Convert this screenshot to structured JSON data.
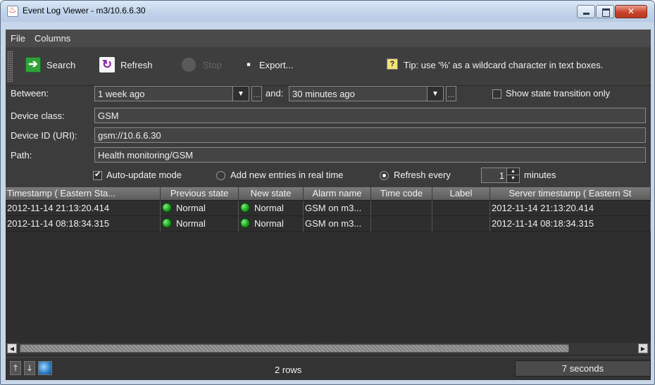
{
  "window": {
    "title": "Event Log Viewer - m3/10.6.6.30"
  },
  "menu": {
    "items": [
      "File",
      "Columns"
    ]
  },
  "toolbar": {
    "search_label": "Search",
    "refresh_label": "Refresh",
    "stop_label": "Stop",
    "export_label": "Export...",
    "tip_text": "Tip: use '%' as a wildcard character in text boxes."
  },
  "filters": {
    "between_label": "Between:",
    "between_value": "1 week ago",
    "and_label": "and:",
    "and_value": "30 minutes ago",
    "show_transitions_label": "Show state transition only",
    "show_transitions_checked": false,
    "device_class_label": "Device class:",
    "device_class_value": "GSM",
    "device_id_label": "Device ID (URI):",
    "device_id_value": "gsm://10.6.6.30",
    "path_label": "Path:",
    "path_value": "Health monitoring/GSM",
    "ellipsis": "...",
    "auto_update_label": "Auto-update mode",
    "auto_update_checked": true,
    "realtime_label": "Add new entries in real time",
    "refresh_every_label": "Refresh every",
    "refresh_every_value": "1",
    "refresh_every_unit": "minutes",
    "selected_mode": "refresh_every"
  },
  "table": {
    "columns": [
      "Timestamp ( Eastern Sta...",
      "Previous state",
      "New state",
      "Alarm name",
      "Time code",
      "Label",
      "Server timestamp ( Eastern St"
    ],
    "rows": [
      {
        "timestamp": "2012-11-14 21:13:20.414",
        "previous_state": "Normal",
        "new_state": "Normal",
        "alarm_name": "GSM on m3...",
        "time_code": "",
        "label": "",
        "server_timestamp": "2012-11-14 21:13:20.414"
      },
      {
        "timestamp": "2012-11-14 08:18:34.315",
        "previous_state": "Normal",
        "new_state": "Normal",
        "alarm_name": "GSM on m3...",
        "time_code": "",
        "label": "",
        "server_timestamp": "2012-11-14 08:18:34.315"
      }
    ],
    "status_color": "#2fbf2f"
  },
  "status": {
    "row_count": "2 rows",
    "elapsed": "7 seconds"
  },
  "icons": {
    "search": "arrow-right-icon",
    "refresh": "refresh-icon",
    "stop": "stop-icon",
    "export": "floppy-disk-icon",
    "tip": "help-icon"
  }
}
